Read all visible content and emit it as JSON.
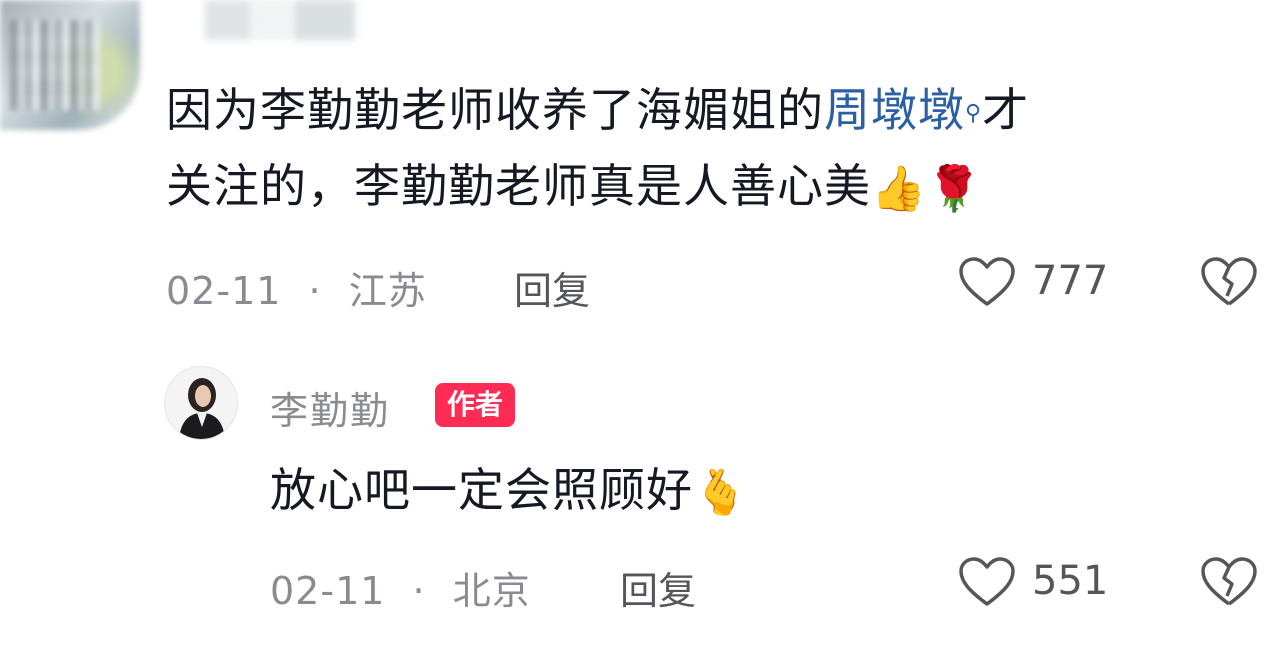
{
  "comment": {
    "text_line1_before": "因为李勤勤老师收养了海媚姐的",
    "text_line1_link": "周墩墩",
    "search_glyph": "⚲",
    "text_line1_after": "才",
    "text_line2": "关注的，李勤勤老师真是人善心美",
    "emoji_thumb": "👍",
    "emoji_rose": "🌹",
    "date": "02-11",
    "separator": "·",
    "location": "江苏",
    "reply_label": "回复",
    "likes": "777"
  },
  "reply": {
    "author": "李勤勤",
    "badge": "作者",
    "text": "放心吧一定会照顾好",
    "emoji_heart_hand": "🫰",
    "date": "02-11",
    "separator": "·",
    "location": "北京",
    "reply_label": "回复",
    "likes": "551"
  },
  "icons": {
    "like": "heart-outline-icon",
    "dislike": "broken-heart-icon"
  },
  "colors": {
    "link": "#2b5fa6",
    "badge": "#fe2c55",
    "meta": "#8a8b91"
  }
}
